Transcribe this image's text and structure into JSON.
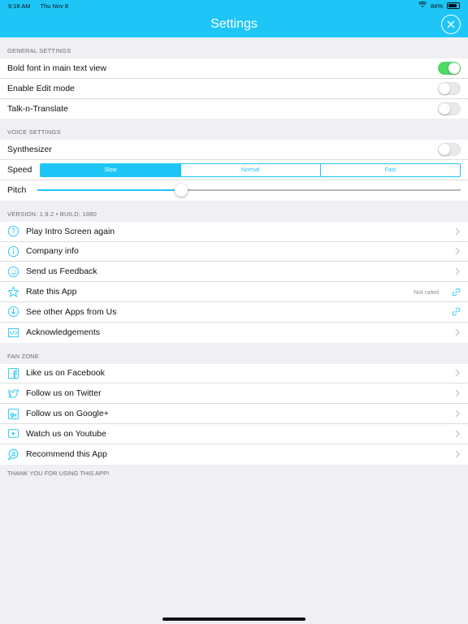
{
  "status": {
    "time": "9:18 AM",
    "date": "Thu Nov 8",
    "battery": "84%",
    "battery_level": 0.84
  },
  "navbar": {
    "title": "Settings"
  },
  "general": {
    "header": "GENERAL SETTINGS",
    "items": [
      {
        "label": "Bold font in main text view",
        "on": true
      },
      {
        "label": "Enable Edit mode",
        "on": false
      },
      {
        "label": "Talk-n-Translate",
        "on": false
      }
    ]
  },
  "voice": {
    "header": "VOICE SETTINGS",
    "synth_label": "Synthesizer",
    "synth_on": false,
    "speed_label": "Speed",
    "speed_options": [
      "Slow",
      "Normal",
      "Fast"
    ],
    "speed_selected": "Slow",
    "pitch_label": "Pitch",
    "pitch_value": 0.34
  },
  "info": {
    "header": "VERSION: 1.9.2  •  BUILD: 1880",
    "items": [
      {
        "label": "Play Intro Screen again",
        "icon": "question-icon"
      },
      {
        "label": "Company info",
        "icon": "info-icon"
      },
      {
        "label": "Send us Feedback",
        "icon": "smiley-icon"
      },
      {
        "label": "Rate this App",
        "icon": "star-icon",
        "trailing": "Not rated"
      },
      {
        "label": "See other Apps from Us",
        "icon": "download-icon"
      },
      {
        "label": "Acknowledgements",
        "icon": "code-icon"
      }
    ]
  },
  "fan": {
    "header": "FAN ZONE",
    "items": [
      {
        "label": "Like us on Facebook",
        "icon": "facebook-icon"
      },
      {
        "label": "Follow us on Twitter",
        "icon": "twitter-icon"
      },
      {
        "label": "Follow us on Google+",
        "icon": "google-plus-icon"
      },
      {
        "label": "Watch us on Youtube",
        "icon": "youtube-icon"
      },
      {
        "label": "Recommend this App",
        "icon": "recommend-icon"
      }
    ]
  },
  "footer": {
    "text": "THANK YOU FOR USING THIS APP!"
  },
  "colors": {
    "accent": "#1ec6f7",
    "toggle_on": "#4cd964"
  }
}
